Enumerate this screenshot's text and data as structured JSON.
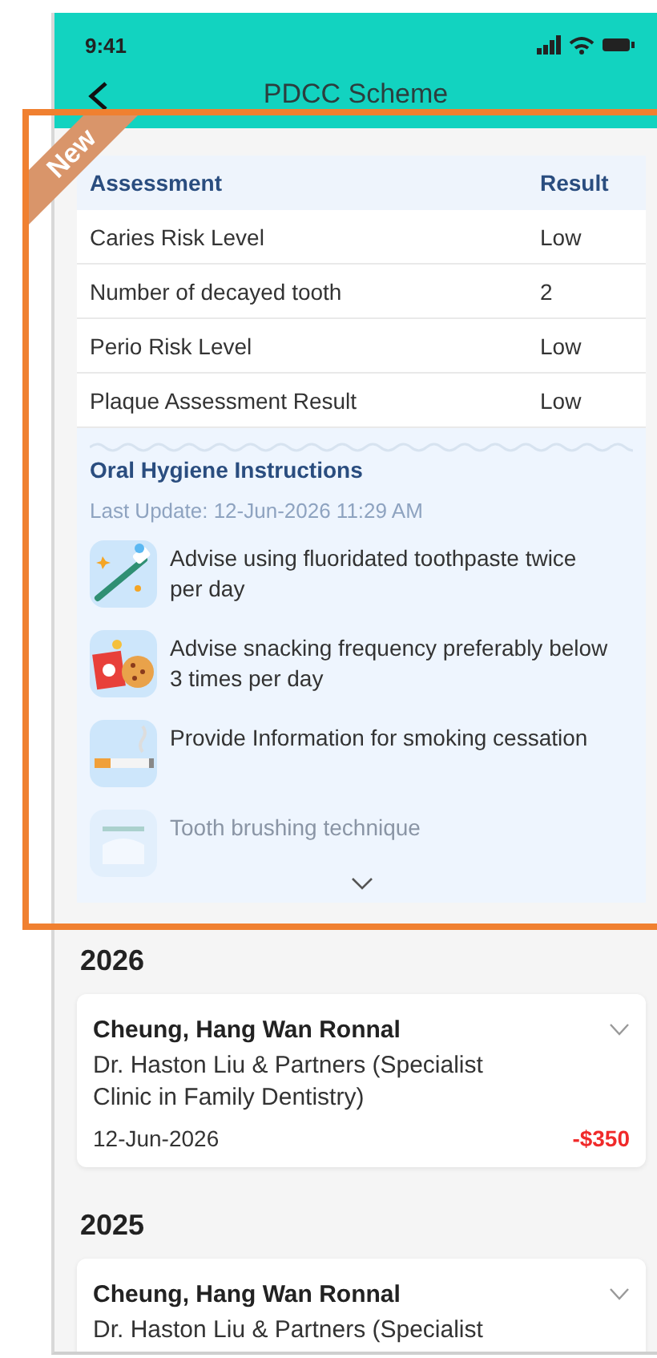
{
  "status_bar": {
    "time": "9:41"
  },
  "nav": {
    "title": "PDCC Scheme"
  },
  "highlight": {
    "badge": "New"
  },
  "assessment_table": {
    "columns": [
      "Assessment",
      "Result"
    ],
    "rows": [
      [
        "Caries Risk Level",
        "Low"
      ],
      [
        "Number of decayed tooth",
        "2"
      ],
      [
        "Perio Risk Level",
        "Low"
      ],
      [
        "Plaque Assessment Result",
        "Low"
      ]
    ]
  },
  "oral_hygiene": {
    "title": "Oral Hygiene Instructions",
    "last_update": "Last Update: 12-Jun-2026 11:29 AM",
    "items": [
      {
        "kind": "toothpaste",
        "text": "Advise using fluoridated toothpaste twice per day",
        "dimmed": false
      },
      {
        "kind": "snacks",
        "text": "Advise snacking frequency preferably below 3 times per day",
        "dimmed": false
      },
      {
        "kind": "smoking",
        "text": "Provide Information for smoking cessation",
        "dimmed": false
      },
      {
        "kind": "brushing",
        "text": "Tooth brushing technique",
        "dimmed": true
      }
    ]
  },
  "years": [
    {
      "year": "2026",
      "records": [
        {
          "patient": "Cheung, Hang Wan Ronnal",
          "clinic": "Dr. Haston Liu & Partners (Specialist Clinic in Family Dentistry)",
          "date": "12-Jun-2026",
          "amount": "-$350"
        }
      ]
    },
    {
      "year": "2025",
      "records": [
        {
          "patient": "Cheung, Hang Wan Ronnal",
          "clinic": "Dr. Haston Liu & Partners (Specialist"
        }
      ]
    }
  ]
}
